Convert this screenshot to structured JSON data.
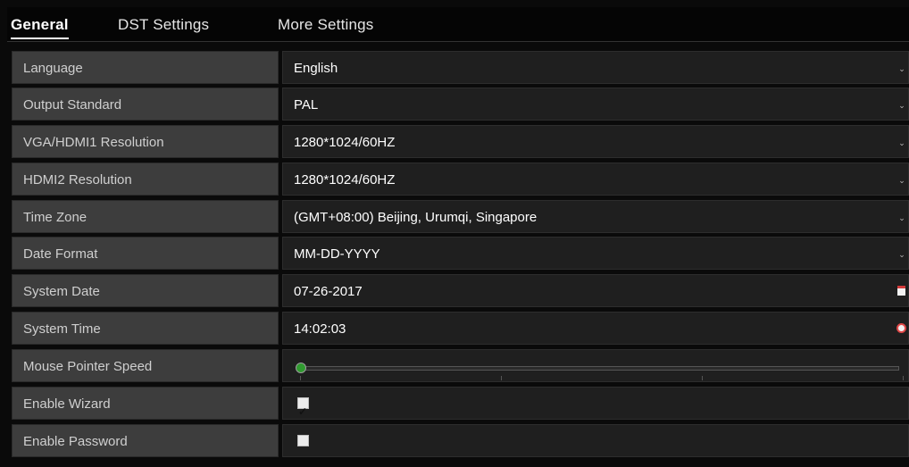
{
  "tabs": [
    {
      "label": "General",
      "active": true
    },
    {
      "label": "DST Settings",
      "active": false
    },
    {
      "label": "More Settings",
      "active": false
    }
  ],
  "rows": [
    {
      "label": "Language",
      "value": "English",
      "control": "dropdown"
    },
    {
      "label": "Output Standard",
      "value": "PAL",
      "control": "dropdown"
    },
    {
      "label": "VGA/HDMI1 Resolution",
      "value": "1280*1024/60HZ",
      "control": "dropdown"
    },
    {
      "label": "HDMI2 Resolution",
      "value": "1280*1024/60HZ",
      "control": "dropdown"
    },
    {
      "label": "Time Zone",
      "value": "(GMT+08:00) Beijing, Urumqi, Singapore",
      "control": "dropdown"
    },
    {
      "label": "Date Format",
      "value": "MM-DD-YYYY",
      "control": "dropdown"
    },
    {
      "label": "System Date",
      "value": "07-26-2017",
      "control": "date",
      "icon": "calendar-icon"
    },
    {
      "label": "System Time",
      "value": "14:02:03",
      "control": "time",
      "icon": "clock-icon"
    },
    {
      "label": "Mouse Pointer Speed",
      "control": "slider",
      "level": 0
    },
    {
      "label": "Enable Wizard",
      "control": "checkbox",
      "checked": true
    },
    {
      "label": "Enable Password",
      "control": "checkbox",
      "checked": false
    }
  ],
  "colors": {
    "label_bg": "#3d3d3d",
    "value_bg": "#1f1f1f",
    "slider_knob": "#2f9a2f",
    "icon_accent": "#d43b3b"
  }
}
